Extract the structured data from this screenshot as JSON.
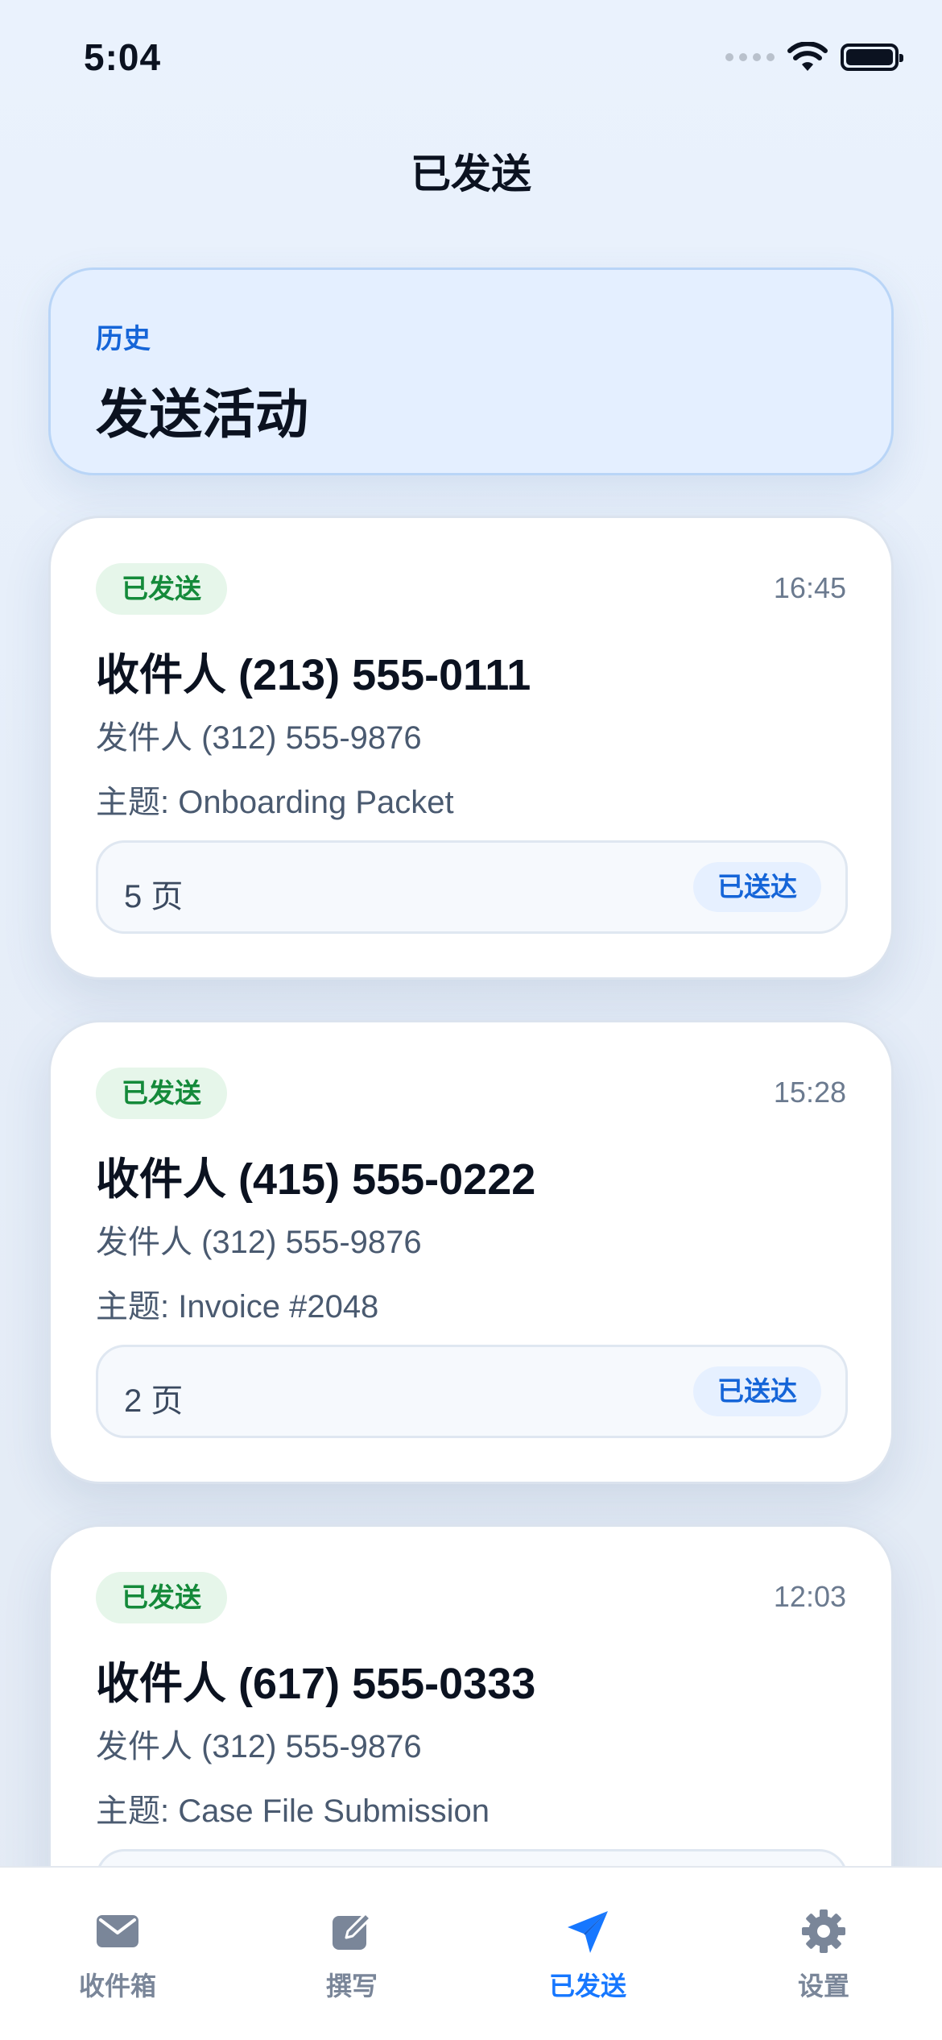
{
  "status_bar": {
    "time": "5:04"
  },
  "nav": {
    "title": "已发送"
  },
  "hero": {
    "eyebrow": "历史",
    "title": "发送活动"
  },
  "faxes": [
    {
      "status": "已发送",
      "time": "16:45",
      "recipient": "收件人 (213) 555-0111",
      "sender": "发件人 (312) 555-9876",
      "subject": "主题: Onboarding Packet",
      "pages": "5 页",
      "delivery": "已送达"
    },
    {
      "status": "已发送",
      "time": "15:28",
      "recipient": "收件人 (415) 555-0222",
      "sender": "发件人 (312) 555-9876",
      "subject": "主题: Invoice #2048",
      "pages": "2 页",
      "delivery": "已送达"
    },
    {
      "status": "已发送",
      "time": "12:03",
      "recipient": "收件人 (617) 555-0333",
      "sender": "发件人 (312) 555-9876",
      "subject": "主题: Case File Submission",
      "pages": "",
      "delivery": ""
    }
  ],
  "tabs": [
    {
      "label": "收件箱",
      "icon": "mail-icon",
      "active": false
    },
    {
      "label": "撰写",
      "icon": "compose-icon",
      "active": false
    },
    {
      "label": "已发送",
      "icon": "send-icon",
      "active": true
    },
    {
      "label": "设置",
      "icon": "gear-icon",
      "active": false
    }
  ],
  "colors": {
    "accent": "#1677ff",
    "sent_badge_bg": "#e6f6ea",
    "sent_badge_text": "#148a3a",
    "delivered_badge_text": "#1565d8",
    "tab_inactive": "#7a8699"
  }
}
